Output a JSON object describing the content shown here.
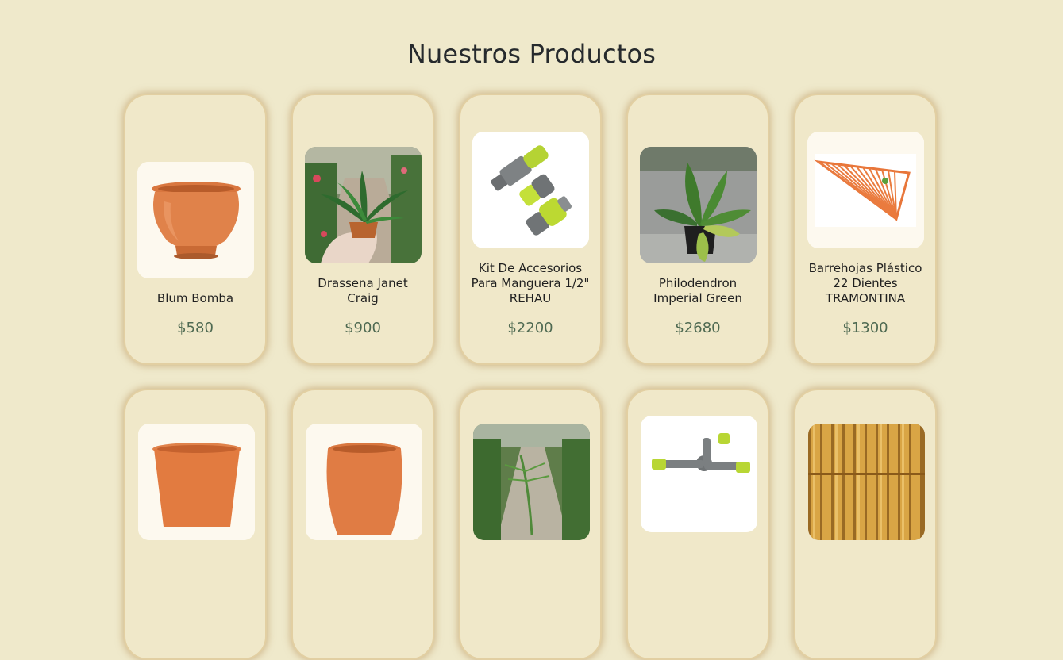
{
  "section_title": "Nuestros Productos",
  "colors": {
    "background": "#efe9cb",
    "card": "#f0e8c9",
    "price": "#4f6a52",
    "title": "#262a2d"
  },
  "products": [
    {
      "name": "Blum Bomba",
      "price": "$580",
      "image": "terracotta-pot-round",
      "name_lines": 1
    },
    {
      "name": "Drassena Janet Craig",
      "price": "$900",
      "image": "dracaena-plant-in-hand",
      "name_lines": 2
    },
    {
      "name": "Kit De Accesorios Para Manguera 1/2\" REHAU",
      "price": "$2200",
      "image": "hose-accessories-kit",
      "name_lines": 3
    },
    {
      "name": "Philodendron Imperial Green",
      "price": "$2680",
      "image": "philodendron-plant",
      "name_lines": 2
    },
    {
      "name": "Barrehojas Plástico 22 Dientes TRAMONTINA",
      "price": "$1300",
      "image": "plastic-leaf-rake",
      "name_lines": 4
    },
    {
      "name": "",
      "price": "",
      "image": "terracotta-pot-wide"
    },
    {
      "name": "",
      "price": "",
      "image": "terracotta-pot-tall"
    },
    {
      "name": "",
      "price": "",
      "image": "palm-in-nursery"
    },
    {
      "name": "",
      "price": "",
      "image": "garden-sprinkler"
    },
    {
      "name": "",
      "price": "",
      "image": "bamboo-canes"
    }
  ]
}
